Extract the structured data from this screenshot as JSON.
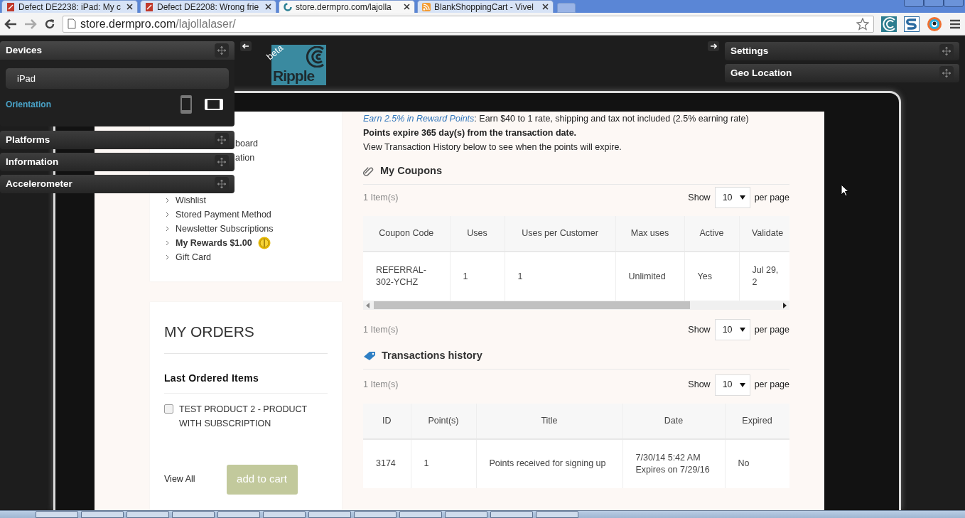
{
  "browser": {
    "tabs": [
      {
        "title": "Defect DE2238: iPad: My c",
        "kind": "defect",
        "selected": false
      },
      {
        "title": "Defect DE2208: Wrong frie",
        "kind": "defect",
        "selected": false
      },
      {
        "title": "store.dermpro.com/lajolla",
        "kind": "site",
        "selected": true
      },
      {
        "title": "BlankShoppingCart - Vivel",
        "kind": "feed",
        "selected": false
      }
    ],
    "address": {
      "host": "store.dermpro.com",
      "path": "/lajollalaser/"
    }
  },
  "ripple": {
    "logo": {
      "text": "Ripple",
      "badge": "beta"
    },
    "left_panels": [
      {
        "title": "Devices",
        "expanded": true,
        "device": "iPad",
        "orientation_label": "Orientation",
        "orientations": [
          {
            "kind": "portrait",
            "selected": false
          },
          {
            "kind": "landscape",
            "selected": true
          }
        ]
      },
      {
        "title": "Platforms",
        "expanded": false
      },
      {
        "title": "Information",
        "expanded": false
      },
      {
        "title": "Accelerometer",
        "expanded": false
      }
    ],
    "right_panels": [
      {
        "title": "Settings",
        "expanded": false
      },
      {
        "title": "Geo Location",
        "expanded": false
      }
    ]
  },
  "page": {
    "menu": [
      {
        "label": "board",
        "kind": "partial"
      },
      {
        "label": "ation",
        "kind": "partial"
      },
      {
        "label": "Wishlist",
        "kind": "link"
      },
      {
        "label": "Stored Payment Method",
        "kind": "link"
      },
      {
        "label": "Newsletter Subscriptions",
        "kind": "link"
      },
      {
        "label": "My Rewards $1.00",
        "kind": "rewards"
      },
      {
        "label": "Gift Card",
        "kind": "link"
      }
    ],
    "orders": {
      "title": "MY ORDERS",
      "subtitle": "Last Ordered Items",
      "items": [
        {
          "label": "TEST PRODUCT 2 - PRODUCT WITH SUBSCRIPTION",
          "checked": false
        }
      ],
      "view_all": "View All",
      "add_to_cart": "add to cart",
      "add_to_cart_disabled": true
    },
    "rewards": {
      "link": "Earn 2.5% in Reward Points",
      "rest": ": Earn $40 to 1 rate, shipping and tax not included (2.5% earning rate)",
      "expiry": "Points expire 365 day(s) from the transaction date.",
      "note": "View Transaction History below to see when the points will expire."
    },
    "coupons": {
      "title": "My Coupons",
      "pagers": [
        {
          "count": "1 Item(s)",
          "show": "Show",
          "value": "10",
          "suffix": "per page"
        },
        {
          "count": "1 Item(s)",
          "show": "Show",
          "value": "10",
          "suffix": "per page"
        }
      ],
      "columns": [
        "Coupon Code",
        "Uses",
        "Uses per Customer",
        "Max uses",
        "Active",
        "Validate"
      ],
      "rows": [
        [
          "REFERRAL-302-YCHZ",
          "1",
          "1",
          "Unlimited",
          "Yes",
          "Jul 29, 2"
        ]
      ]
    },
    "transactions": {
      "title": "Transactions history",
      "pagers": [
        {
          "count": "1 Item(s)",
          "show": "Show",
          "value": "10",
          "suffix": "per page"
        }
      ],
      "columns": [
        "ID",
        "Point(s)",
        "Title",
        "Date",
        "Expired"
      ],
      "rows": [
        [
          "3174",
          "1",
          "Points received for signing up",
          "7/30/14 5:42 AM\nExpires on 7/29/16",
          "No"
        ]
      ]
    }
  }
}
